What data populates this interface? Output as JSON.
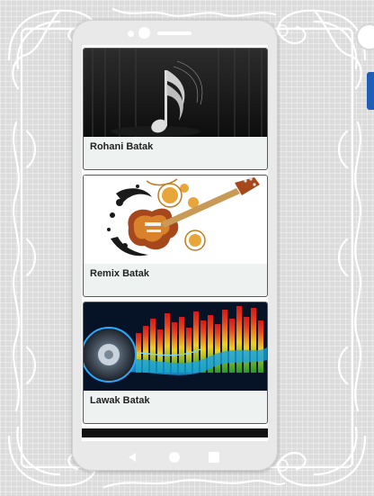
{
  "categories": [
    {
      "label": "Rohani Batak",
      "image": "music-note-image"
    },
    {
      "label": "Remix Batak",
      "image": "electric-guitar-image"
    },
    {
      "label": "Lawak Batak",
      "image": "speaker-equalizer-image"
    }
  ],
  "nav": {
    "back_icon": "back-triangle-icon",
    "home_icon": "home-circle-icon",
    "recent_icon": "recent-square-icon"
  },
  "colors": {
    "card_label_bg": "#eef3f1",
    "card_border": "#5a5a5a",
    "phone_frame": "#e9e9e9",
    "side_tab": "#1f5fb8"
  }
}
